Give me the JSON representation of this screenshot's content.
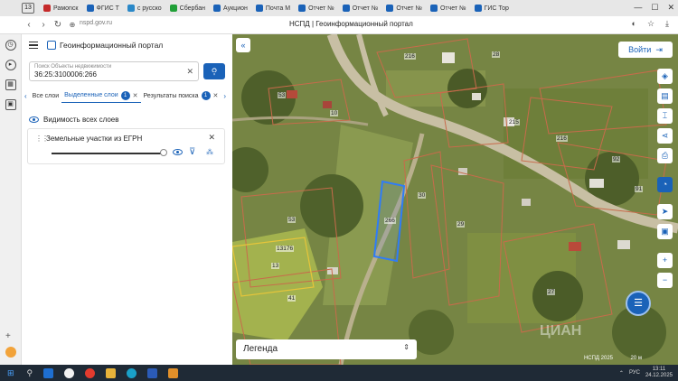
{
  "browser": {
    "tab_count": "13",
    "tabs": [
      {
        "label": "Рамоnск",
        "color": "#c52a2a"
      },
      {
        "label": "ФГИС Т",
        "color": "#1a62b8"
      },
      {
        "label": "с русско",
        "color": "#2a88c8"
      },
      {
        "label": "Сбербан",
        "color": "#21a038"
      },
      {
        "label": "Аукцион",
        "color": "#1a62b8"
      },
      {
        "label": "Почта М",
        "color": "#1a62b8"
      },
      {
        "label": "Отчет №",
        "color": "#1a62b8"
      },
      {
        "label": "Отчет №",
        "color": "#1a62b8"
      },
      {
        "label": "Отчет №",
        "color": "#1a62b8"
      },
      {
        "label": "Отчет №",
        "color": "#1a62b8"
      },
      {
        "label": "ГИС Тор",
        "color": "#1a62b8"
      }
    ],
    "url": "nspd.gov.ru",
    "page_title": "НСПД | Геоинформационный портал"
  },
  "portal": {
    "title": "Геоинформационный портал",
    "search": {
      "placeholder": "Поиск Объекты недвижимости",
      "value": "36:25:3100006:266"
    },
    "tabs": [
      {
        "label": "Все слои",
        "badge": ""
      },
      {
        "label": "Выделенные слои",
        "badge": "1"
      },
      {
        "label": "Результаты поиска",
        "badge": "1"
      }
    ],
    "visibility_all": "Видимость всех слоев",
    "layer_name": "Земельные участки из ЕГРН",
    "layer_opacity": 1.0
  },
  "map": {
    "login_label": "Войти",
    "legend_label": "Легенда",
    "scale_label": "20 м",
    "copyright": "НСПД 2025",
    "watermark": "ЦИАН",
    "parcels": [
      "216",
      "28",
      "53",
      "10",
      "215",
      "216",
      "92",
      "30",
      "266",
      "29",
      "91",
      "53",
      "13176",
      "13",
      "41",
      "27"
    ]
  },
  "taskbar": {
    "time": "13:11",
    "date": "24.12.2025",
    "lang": "РУС"
  }
}
